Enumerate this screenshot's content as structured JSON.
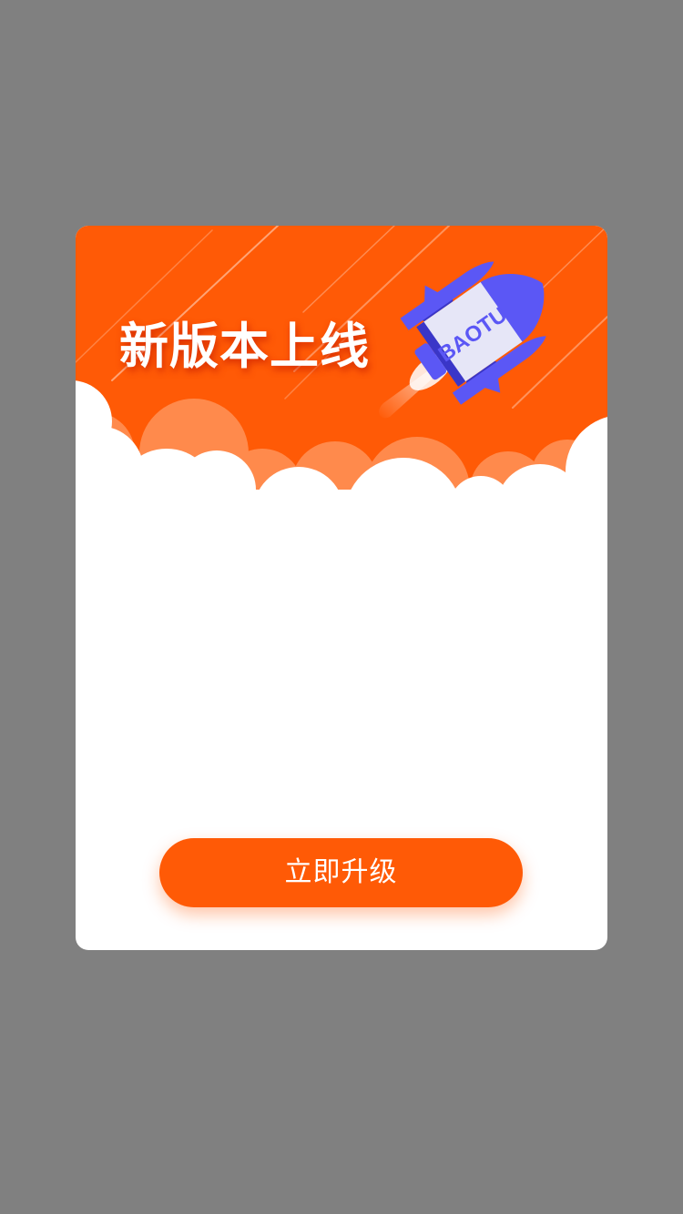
{
  "dialog": {
    "title": "新版本上线",
    "rocket_label": "BAOTU",
    "button_label": "立即升级"
  },
  "colors": {
    "overlay": "#808080",
    "banner": "#ff5a06",
    "cloud_back": "#ff8a4c",
    "button": "#ff5a06",
    "rocket_body": "#e6e6f7",
    "rocket_accent": "#5b57f5"
  }
}
